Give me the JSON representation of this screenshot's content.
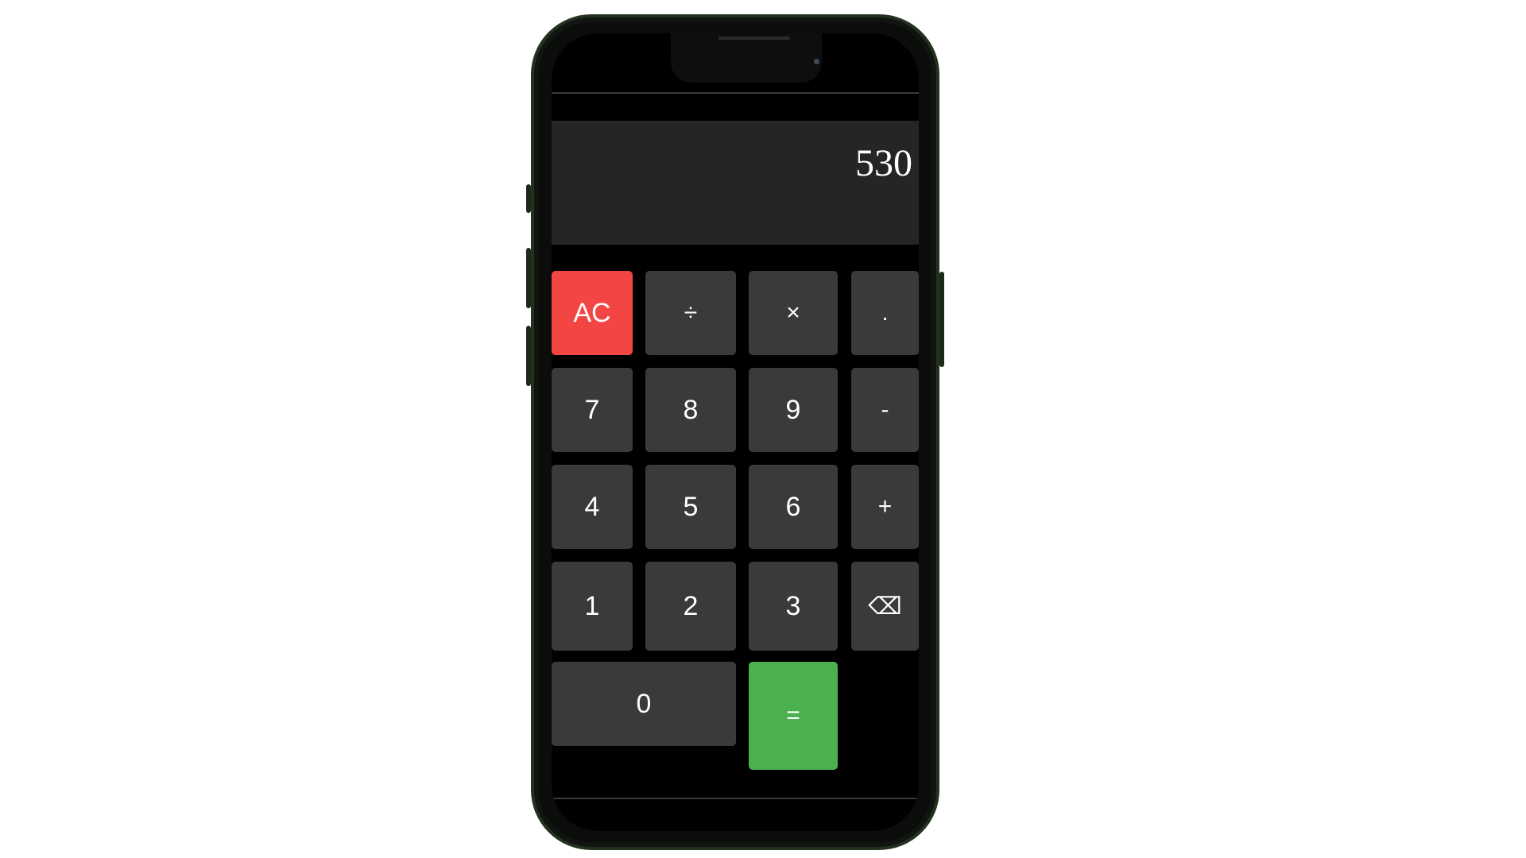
{
  "display": {
    "value": "530"
  },
  "keys": {
    "clear": "AC",
    "divide": "÷",
    "multiply": "×",
    "decimal": ".",
    "seven": "7",
    "eight": "8",
    "nine": "9",
    "minus": "-",
    "four": "4",
    "five": "5",
    "six": "6",
    "plus": "+",
    "one": "1",
    "two": "2",
    "three": "3",
    "backspace": "⌫",
    "zero": "0",
    "equals": "="
  },
  "colors": {
    "clear_key": "#f44545",
    "equals_key": "#4caf50",
    "key": "#3a3a3a",
    "display_bg": "#252525",
    "frame": "#23321f"
  }
}
